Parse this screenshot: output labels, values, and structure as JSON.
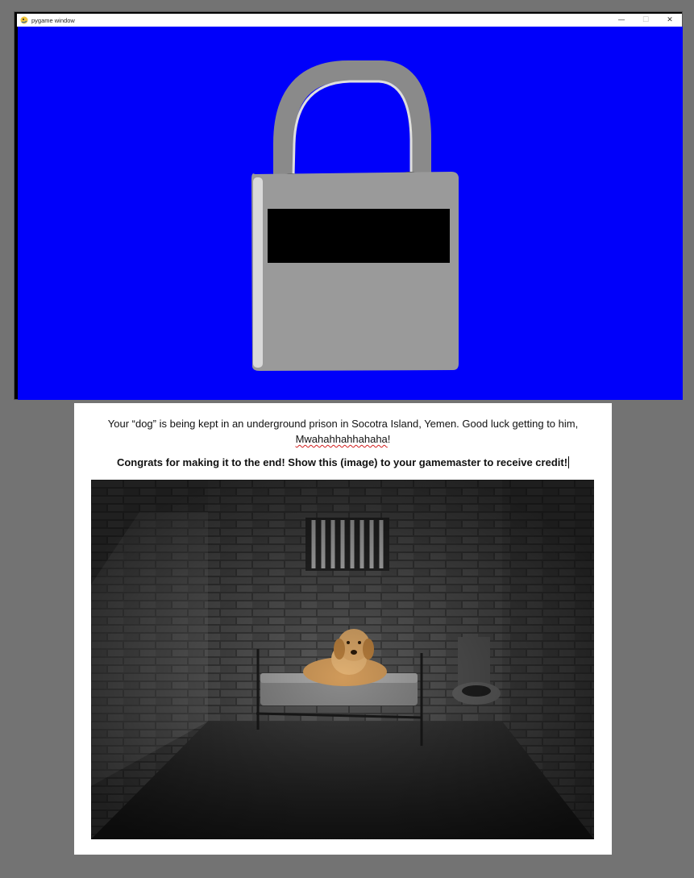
{
  "window": {
    "title": "pygame window",
    "controls": {
      "minimize": "—",
      "maximize": "☐",
      "close": "✕"
    },
    "canvas_background": "#0000fa",
    "lock_icon": "padlock-icon",
    "app_icon": "pygame-snake-icon"
  },
  "document": {
    "line1_text": "Your “dog” is being kept in an underground prison in Socotra Island, Yemen. Good luck getting to him,",
    "line1_misspelled": "Mwahahhahhahaha",
    "line1_end": "!",
    "line2_text": "Congrats for making it to the end! Show this (image) to your gamemaster to receive credit!",
    "image_description_icon": "prison-cell-dog-image"
  },
  "colors": {
    "desktop": "#737373",
    "lock_body": "#999999",
    "lock_shackle": "#8a8a8a",
    "lock_display": "#000000",
    "spellcheck": "#d21e1e"
  }
}
